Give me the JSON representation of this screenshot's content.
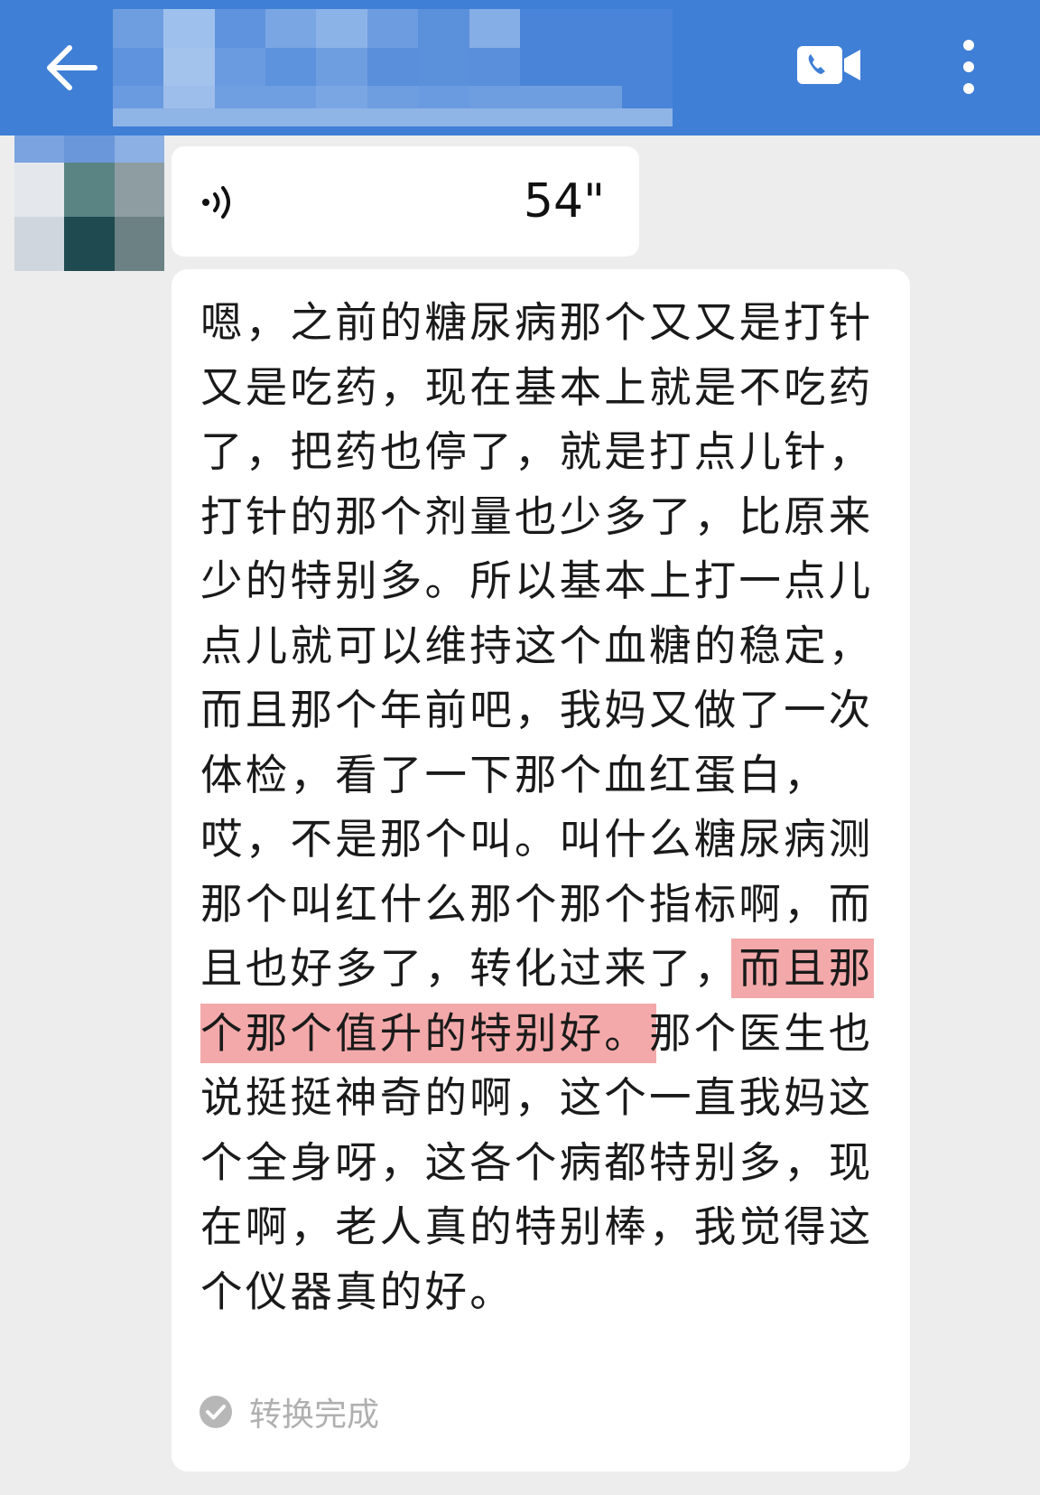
{
  "header": {
    "back_icon": "arrow-left-icon",
    "video_call_icon": "video-call-icon",
    "more_icon": "more-vertical-icon",
    "accent_color": "#3f7fd6"
  },
  "voice_message": {
    "icon": "voice-wave-icon",
    "duration": "54\""
  },
  "transcript": {
    "part1": "嗯，之前的糖尿病那个又又是打针又是吃药，现在基本上就是不吃药了，把药也停了，就是打点儿针，打针的那个剂量也少多了，比原来少的特别多。所以基本上打一点儿点儿就可以维持这个血糖的稳定，而且那个年前吧，我妈又做了一次体检，看了一下那个血红蛋白，哎，不是那个叫。叫什么糖尿病测那个叫红什么那个那个指标啊，而且也好多了，转化过来了，",
    "highlight": "而且那个那个值升的特别好。",
    "part2": "那个医生也说挺挺神奇的啊，这个一直我妈这个全身呀，这各个病都特别多，现在啊，老人真的特别棒，我觉得这个仪器真的好。",
    "highlight_color": "#f3a9aa"
  },
  "status": {
    "icon": "check-circle-icon",
    "text": "转换完成"
  }
}
